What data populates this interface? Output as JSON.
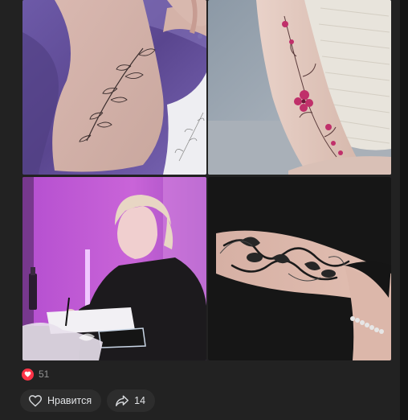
{
  "post": {
    "photos": [
      {
        "alt": "leg-vine-tattoo"
      },
      {
        "alt": "forearm-flower-tattoo"
      },
      {
        "alt": "tattoo-artist-drawing"
      },
      {
        "alt": "forearm-dragon-tattoo"
      }
    ],
    "reactions": {
      "icon": "heart-icon",
      "count": "51",
      "color": "#ff3347"
    },
    "actions": {
      "like_label": "Нравится",
      "like_icon": "heart-outline-icon",
      "share_icon": "share-arrow-icon",
      "share_count": "14"
    }
  }
}
